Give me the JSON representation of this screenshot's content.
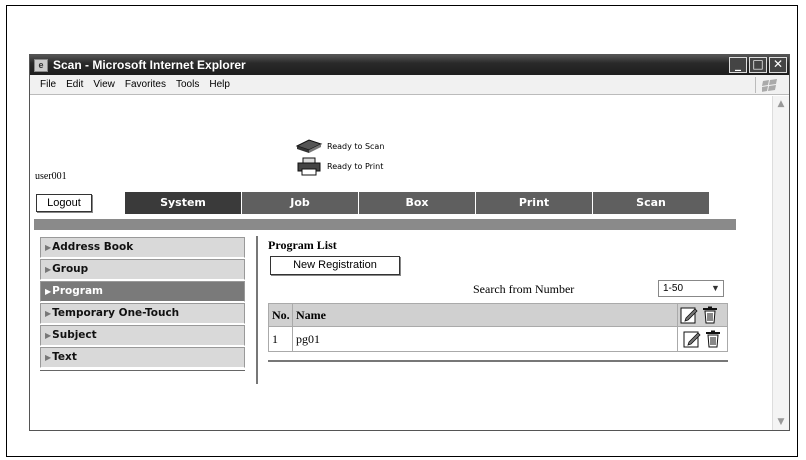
{
  "window": {
    "title": "Scan - Microsoft Internet Explorer",
    "buttons": [
      "_",
      "□",
      "✕"
    ]
  },
  "menubar": [
    "File",
    "Edit",
    "View",
    "Favorites",
    "Tools",
    "Help"
  ],
  "status": {
    "scan": "Ready to Scan",
    "print": "Ready to Print"
  },
  "user": "user001",
  "logout_label": "Logout",
  "tabs": [
    "System",
    "Job",
    "Box",
    "Print",
    "Scan"
  ],
  "sidebar": {
    "items": [
      {
        "label": "Address Book",
        "active": false
      },
      {
        "label": "Group",
        "active": false
      },
      {
        "label": "Program",
        "active": true
      },
      {
        "label": "Temporary One-Touch",
        "active": false
      },
      {
        "label": "Subject",
        "active": false
      },
      {
        "label": "Text",
        "active": false
      }
    ]
  },
  "main": {
    "title": "Program List",
    "new_registration_label": "New Registration",
    "search_label": "Search from Number",
    "range_value": "1-50",
    "columns": [
      "No.",
      "Name"
    ],
    "rows": [
      {
        "no": "1",
        "name": "pg01"
      }
    ]
  },
  "colors": {
    "titlebar": "#2a2a2a",
    "tab": "#5f5f5f",
    "active_nav": "#7a7a7a",
    "nav": "#d9d9d9",
    "table_header": "#d0d0d0"
  }
}
